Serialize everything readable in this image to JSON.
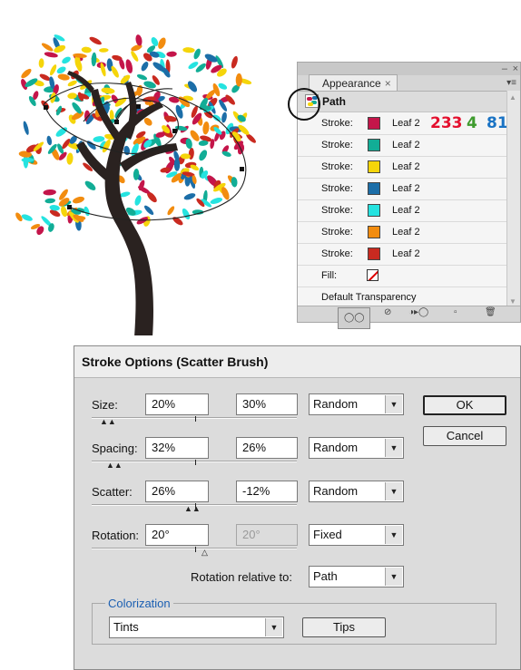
{
  "appearance": {
    "tab_label": "Appearance",
    "tab_close": "×",
    "window_min": "–",
    "window_close": "×",
    "menu_icon": "▾≡",
    "path_label": "Path",
    "strokes": [
      {
        "label": "Stroke:",
        "brush": "Leaf 2",
        "color": "#c4154a"
      },
      {
        "label": "Stroke:",
        "brush": "Leaf 2",
        "color": "#12ad96"
      },
      {
        "label": "Stroke:",
        "brush": "Leaf 2",
        "color": "#f5d50a"
      },
      {
        "label": "Stroke:",
        "brush": "Leaf 2",
        "color": "#1c6ea8"
      },
      {
        "label": "Stroke:",
        "brush": "Leaf 2",
        "color": "#25e3e0"
      },
      {
        "label": "Stroke:",
        "brush": "Leaf 2",
        "color": "#f28c0f"
      },
      {
        "label": "Stroke:",
        "brush": "Leaf 2",
        "color": "#c92a20"
      }
    ],
    "rgb_annotation": {
      "r": "233",
      "g": "4",
      "b": "81",
      "r_color": "#e4102e",
      "g_color": "#3f9b2e",
      "b_color": "#1a73c4"
    },
    "fill_label": "Fill:",
    "transparency_label": "Default Transparency",
    "bottom_icons": [
      "new-art-icon",
      "clear-icon",
      "reduce-basic-icon",
      "duplicate-icon",
      "delete-icon"
    ]
  },
  "dialog": {
    "title": "Stroke Options (Scatter Brush)",
    "size": {
      "label": "Size:",
      "min": "20%",
      "max": "30%",
      "mode": "Random"
    },
    "spacing": {
      "label": "Spacing:",
      "min": "32%",
      "max": "26%",
      "mode": "Random"
    },
    "scatter": {
      "label": "Scatter:",
      "min": "26%",
      "max": "-12%",
      "mode": "Random"
    },
    "rotation": {
      "label": "Rotation:",
      "min": "20°",
      "max": "20°",
      "mode": "Fixed"
    },
    "rotation_relative": {
      "label": "Rotation relative to:",
      "value": "Path"
    },
    "colorization": {
      "title": "Colorization",
      "method": "Tints",
      "tips_label": "Tips"
    },
    "ok_label": "OK",
    "cancel_label": "Cancel"
  },
  "colors": {
    "trunk": "#2a2220",
    "leaf_colors": [
      "#c4154a",
      "#12ad96",
      "#f5d50a",
      "#1c6ea8",
      "#25e3e0",
      "#f28c0f",
      "#c92a20"
    ]
  }
}
